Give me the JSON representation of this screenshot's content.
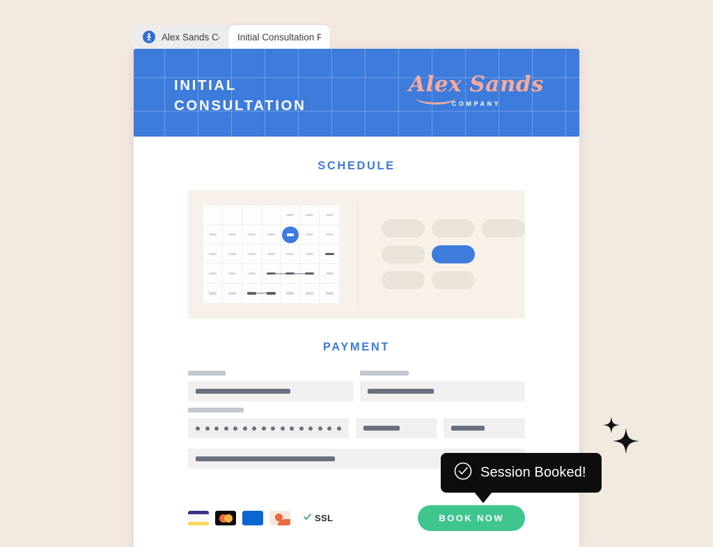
{
  "colors": {
    "page_background": "#f2e9e0",
    "header_blue": "#3d7bdc",
    "brand_pink": "#f7aa9c",
    "button_green": "#3fc68e",
    "toast_black": "#0d0d0d",
    "panel_cream": "#f7f1ea"
  },
  "browser": {
    "tabs": [
      {
        "label": "Alex Sands Co.",
        "active": false,
        "favicon": "alex-sands-favicon"
      },
      {
        "label": "Initial Consultation Fo",
        "active": true,
        "favicon": ""
      }
    ]
  },
  "header": {
    "title": "INITIAL\nCONSULTATION",
    "brand_name": "Alex Sands",
    "brand_sub": "COMPANY"
  },
  "schedule": {
    "section_title": "SCHEDULE",
    "calendar": {
      "columns": 7,
      "rows": 5,
      "selected_cell_index": 11,
      "empty_cells": [
        0,
        1,
        2,
        3
      ],
      "booked_cells": [
        20,
        24,
        25,
        26,
        30,
        31
      ]
    },
    "slots": [
      {
        "state": "available"
      },
      {
        "state": "available"
      },
      {
        "state": "available"
      },
      {
        "state": "available"
      },
      {
        "state": "selected"
      },
      {
        "state": "hidden"
      },
      {
        "state": "available"
      },
      {
        "state": "available"
      },
      {
        "state": "hidden"
      }
    ]
  },
  "payment": {
    "section_title": "PAYMENT",
    "fields": [
      {
        "name": "cardholder-name-field",
        "label_width": "w-sm",
        "value_width": "v-1",
        "type": "text"
      },
      {
        "name": "billing-email-field",
        "label_width": "w-md",
        "value_width": "v-2",
        "type": "text"
      },
      {
        "name": "card-number-field",
        "label_width": "w-lg",
        "value_width": "",
        "type": "masked",
        "mask_dot_count": 16
      },
      {
        "name": "expiry-field",
        "label_width": "",
        "value_width": "v-3",
        "type": "text"
      },
      {
        "name": "cvv-field",
        "label_width": "",
        "value_width": "v-4",
        "type": "text"
      },
      {
        "name": "billing-address-field",
        "label_width": "",
        "value_width": "v-5",
        "type": "text"
      }
    ]
  },
  "footer": {
    "card_icons": [
      {
        "name": "visa-card-icon",
        "style": "visa"
      },
      {
        "name": "mastercard-card-icon",
        "style": "mc"
      },
      {
        "name": "blue-card-icon",
        "style": "blue"
      },
      {
        "name": "peach-card-icon",
        "style": "peach"
      }
    ],
    "ssl_label": "SSL",
    "ssl_icon": "check-icon",
    "book_button_label": "BOOK NOW"
  },
  "toast": {
    "message": "Session Booked!",
    "icon": "check-circle-icon"
  },
  "decorations": {
    "sparkles": [
      "sparkle-small",
      "sparkle-large"
    ]
  }
}
